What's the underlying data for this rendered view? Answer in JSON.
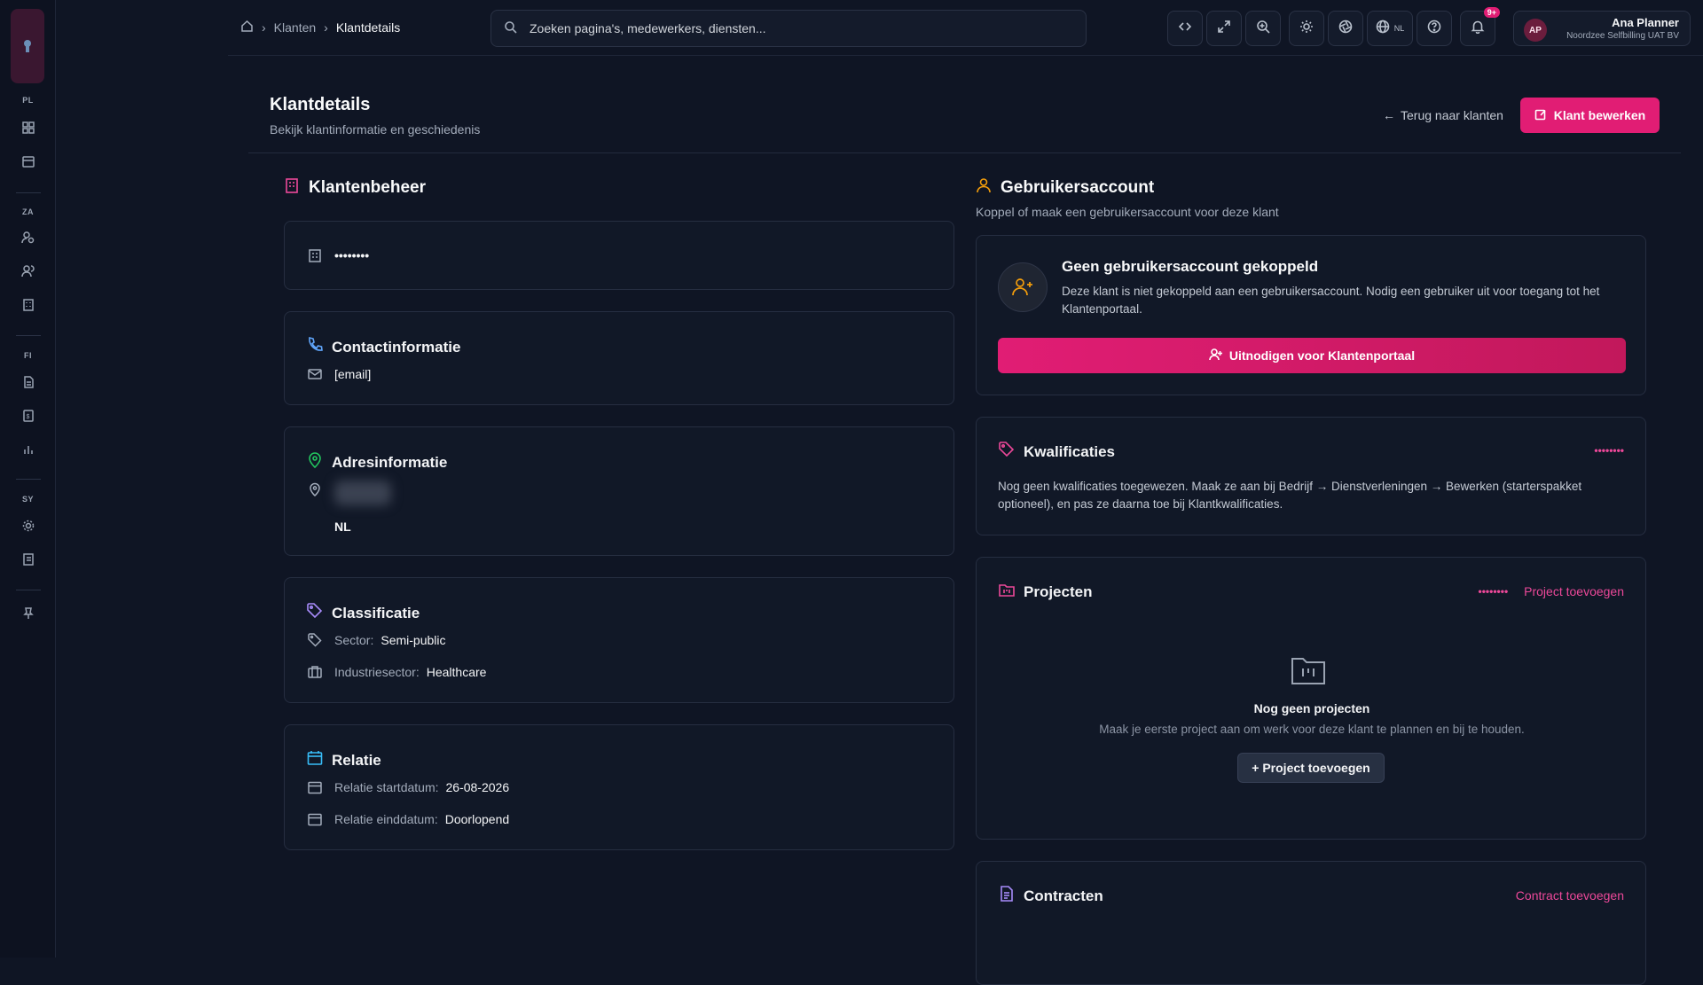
{
  "sidebar": {
    "sections": [
      {
        "label": "PL",
        "items": [
          "dashboard-icon",
          "calendar-icon"
        ]
      },
      {
        "label": "ZA",
        "items": [
          "user-search-icon",
          "users-icon",
          "building-icon"
        ]
      },
      {
        "label": "FI",
        "items": [
          "document-icon",
          "invoice-icon",
          "chart-icon"
        ]
      },
      {
        "label": "SY",
        "items": [
          "settings-icon",
          "log-icon"
        ]
      }
    ]
  },
  "breadcrumb": {
    "items": [
      "Klanten",
      "Klantdetails"
    ]
  },
  "search": {
    "placeholder": "Zoeken pagina's, medewerkers, diensten..."
  },
  "topbar": {
    "language": "NL",
    "notifications_badge": "9+"
  },
  "user": {
    "initials": "AP",
    "name": "Ana Planner",
    "org": "Noordzee Selfbilling UAT BV"
  },
  "page": {
    "title": "Klantdetails",
    "subtitle": "Bekijk klantinformatie en geschiedenis",
    "back_label": "Terug naar klanten",
    "edit_label": "Klant bewerken"
  },
  "left": {
    "section_title": "Klantenbeheer",
    "company_name_masked": "••••••••",
    "contact": {
      "title": "Contactinformatie",
      "email": "[email]"
    },
    "address": {
      "title": "Adresinformatie",
      "country": "NL"
    },
    "classification": {
      "title": "Classificatie",
      "sector_label": "Sector:",
      "sector_value": "Semi-public",
      "industry_label": "Industriesector:",
      "industry_value": "Healthcare"
    },
    "relation": {
      "title": "Relatie",
      "start_label": "Relatie startdatum:",
      "start_value": "26-08-2026",
      "end_label": "Relatie einddatum:",
      "end_value": "Doorlopend"
    }
  },
  "right": {
    "account": {
      "title": "Gebruikersaccount",
      "subtitle": "Koppel of maak een gebruikersaccount voor deze klant",
      "card_title": "Geen gebruikersaccount gekoppeld",
      "card_text": "Deze klant is niet gekoppeld aan een gebruikersaccount. Nodig een gebruiker uit voor toegang tot het Klantenportaal.",
      "invite_label": "Uitnodigen voor Klantenportaal"
    },
    "qualifications": {
      "title": "Kwalificaties",
      "masked": "••••••••",
      "text": "Nog geen kwalificaties toegewezen. Maak ze aan bij Bedrijf → Dienstverleningen → Bewerken (starterspakket optioneel), en pas ze daarna toe bij Klantkwalificaties."
    },
    "projects": {
      "title": "Projecten",
      "masked": "••••••••",
      "add_link": "Project toevoegen",
      "empty_title": "Nog geen projecten",
      "empty_text": "Maak je eerste project aan om werk voor deze klant te plannen en bij te houden.",
      "add_button": "+ Project toevoegen"
    },
    "contracts": {
      "title": "Contracten",
      "add_link": "Contract toevoegen"
    }
  },
  "colors": {
    "accent": "#e11d74",
    "background": "#0f1524",
    "card": "#111827"
  }
}
